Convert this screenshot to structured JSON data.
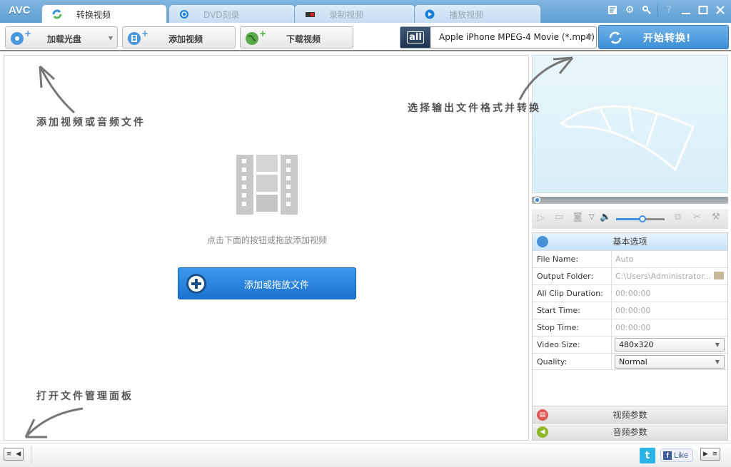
{
  "app": {
    "logo": "AVC"
  },
  "tabs": [
    {
      "label": "转换视频",
      "icon": "convert-icon",
      "active": true
    },
    {
      "label": "DVD刻录",
      "icon": "disc-icon",
      "active": false
    },
    {
      "label": "录制视频",
      "icon": "record-icon",
      "active": false
    },
    {
      "label": "播放视频",
      "icon": "play-icon",
      "active": false
    }
  ],
  "window_controls": [
    "register-icon",
    "settings-icon",
    "key-icon",
    "help-icon",
    "minimize-icon",
    "maximize-icon",
    "close-icon"
  ],
  "help_label": "?",
  "toolbar": {
    "load_disc": "加载光盘",
    "add_video": "添加视频",
    "download_video": "下载视频",
    "format_icon_text": "all",
    "format_value": "Apple iPhone MPEG-4 Movie (*.mp4)",
    "start": "开始转换!"
  },
  "hints": {
    "add_files": "添加视频或音频文件",
    "choose_format": "选择输出文件格式并转换",
    "open_manager": "打开文件管理面板"
  },
  "main": {
    "empty_hint": "点击下面的按钮或拖放添加视频",
    "add_button": "添加或拖放文件"
  },
  "player": {
    "seek_progress": 0,
    "volume": 0.55
  },
  "settings": {
    "basic_title": "基本选项",
    "rows": [
      {
        "label": "File Name:",
        "value": "Auto"
      },
      {
        "label": "Output Folder:",
        "value": "C:\\Users\\Administrator..."
      },
      {
        "label": "All Clip Duration:",
        "value": "00:00:00"
      },
      {
        "label": "Start Time:",
        "value": "00:00:00"
      },
      {
        "label": "Stop Time:",
        "value": "00:00:00"
      },
      {
        "label": "Video Size:",
        "value": "480x320"
      },
      {
        "label": "Quality:",
        "value": "Normal"
      }
    ],
    "video_params": "视频参数",
    "audio_params": "音频参数"
  },
  "statusbar": {
    "like": "Like"
  },
  "colors": {
    "accent": "#3e8fd6",
    "titlebar": "#6faadb"
  }
}
